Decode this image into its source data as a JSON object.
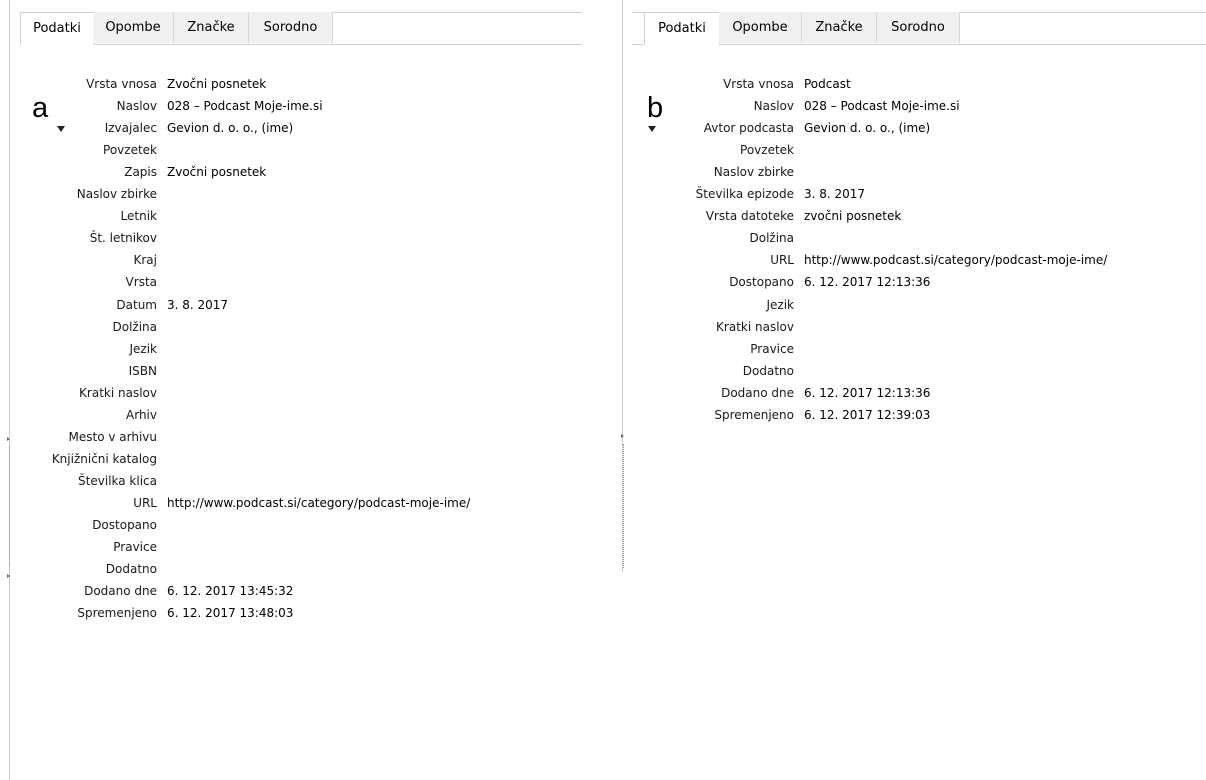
{
  "panel_a": {
    "letter": "a",
    "tabs": [
      "Podatki",
      "Opombe",
      "Značke",
      "Sorodno"
    ],
    "active_tab": "Podatki",
    "fields": [
      {
        "label": "Vrsta vnosa",
        "value": "Zvočni posnetek"
      },
      {
        "label": "Naslov",
        "value": "028 – Podcast Moje-ime.si"
      },
      {
        "label": "Izvajalec",
        "value": "Gevion d. o. o., (ime)",
        "expander": true
      },
      {
        "label": "Povzetek",
        "value": ""
      },
      {
        "label": "Zapis",
        "value": "Zvočni posnetek"
      },
      {
        "label": "Naslov zbirke",
        "value": ""
      },
      {
        "label": "Letnik",
        "value": ""
      },
      {
        "label": "Št. letnikov",
        "value": ""
      },
      {
        "label": "Kraj",
        "value": ""
      },
      {
        "label": "Vrsta",
        "value": ""
      },
      {
        "label": "Datum",
        "value": "3. 8. 2017"
      },
      {
        "label": "Dolžina",
        "value": ""
      },
      {
        "label": "Jezik",
        "value": ""
      },
      {
        "label": "ISBN",
        "value": ""
      },
      {
        "label": "Kratki naslov",
        "value": ""
      },
      {
        "label": "Arhiv",
        "value": ""
      },
      {
        "label": "Mesto v arhivu",
        "value": ""
      },
      {
        "label": "Knjižnični katalog",
        "value": ""
      },
      {
        "label": "Številka klica",
        "value": ""
      },
      {
        "label": "URL",
        "value": "http://www.podcast.si/category/podcast-moje-ime/"
      },
      {
        "label": "Dostopano",
        "value": ""
      },
      {
        "label": "Pravice",
        "value": ""
      },
      {
        "label": "Dodatno",
        "value": ""
      },
      {
        "label": "Dodano dne",
        "value": "6. 12. 2017 13:45:32"
      },
      {
        "label": "Spremenjeno",
        "value": "6. 12. 2017 13:48:03"
      }
    ]
  },
  "panel_b": {
    "letter": "b",
    "tabs": [
      "Podatki",
      "Opombe",
      "Značke",
      "Sorodno"
    ],
    "active_tab": "Podatki",
    "fields": [
      {
        "label": "Vrsta vnosa",
        "value": "Podcast"
      },
      {
        "label": "Naslov",
        "value": "028 – Podcast Moje-ime.si"
      },
      {
        "label": "Avtor podcasta",
        "value": "Gevion d. o. o., (ime)",
        "expander": true
      },
      {
        "label": "Povzetek",
        "value": ""
      },
      {
        "label": "Naslov zbirke",
        "value": ""
      },
      {
        "label": "Številka epizode",
        "value": "3. 8. 2017"
      },
      {
        "label": "Vrsta datoteke",
        "value": "zvočni posnetek"
      },
      {
        "label": "Dolžina",
        "value": ""
      },
      {
        "label": "URL",
        "value": "http://www.podcast.si/category/podcast-moje-ime/"
      },
      {
        "label": "Dostopano",
        "value": "6. 12. 2017 12:13:36"
      },
      {
        "label": "Jezik",
        "value": ""
      },
      {
        "label": "Kratki naslov",
        "value": ""
      },
      {
        "label": "Pravice",
        "value": ""
      },
      {
        "label": "Dodatno",
        "value": ""
      },
      {
        "label": "Dodano dne",
        "value": "6. 12. 2017 12:13:36"
      },
      {
        "label": "Spremenjeno",
        "value": "6. 12. 2017 12:39:03"
      }
    ]
  }
}
